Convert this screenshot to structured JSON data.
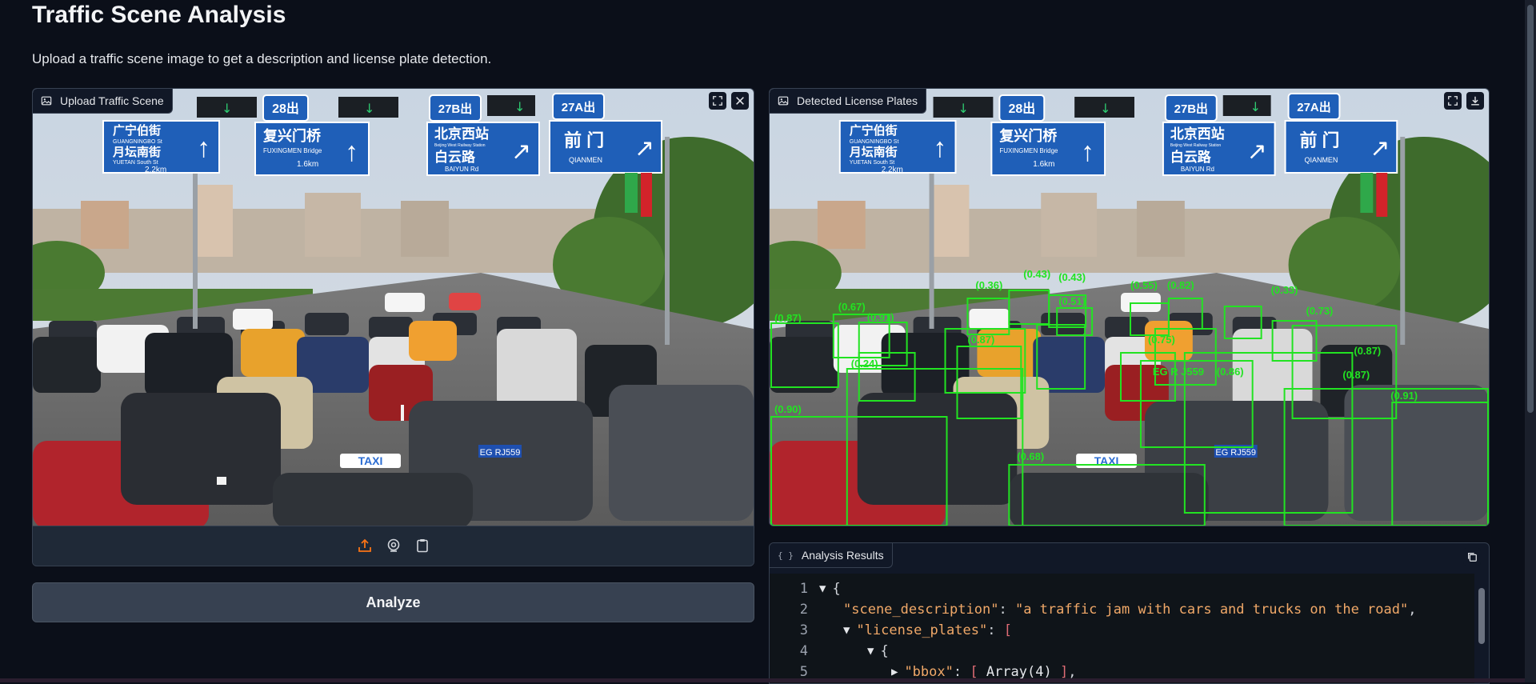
{
  "page": {
    "title": "Traffic Scene Analysis",
    "description": "Upload a traffic scene image to get a description and license plate detection."
  },
  "input_panel": {
    "label": "Upload Traffic Scene",
    "label_icon": "image-icon",
    "corner_icons": [
      "fullscreen-icon",
      "close-icon"
    ],
    "source_icons": [
      "upload-icon",
      "webcam-icon",
      "clipboard-icon"
    ],
    "accent": "#f97316"
  },
  "output_panel": {
    "label": "Detected License Plates",
    "label_icon": "image-icon",
    "corner_icons": [
      "fullscreen-icon",
      "download-icon"
    ]
  },
  "scene": {
    "signs": [
      {
        "cn": "广宁伯街",
        "en1": "GUANGNINGBO St",
        "cn2": "月坛南街",
        "en2": "YUETAN South St",
        "dist": "2.2km",
        "arrow": "↑"
      },
      {
        "cn": "复兴门桥",
        "en1": "FUXINGMEN Bridge",
        "dist": "1.6km",
        "arrow": "↑"
      },
      {
        "cn": "北京西站",
        "en1": "Beijing West Railway Station",
        "cn2": "白云路",
        "en2": "BAIYUN Rd",
        "arrow": "↗"
      },
      {
        "cn": "前 门",
        "en1": "QIANMEN",
        "arrow": "↗"
      }
    ],
    "route_badges": [
      "28出",
      "27B出",
      "27A出"
    ],
    "plate_text": "EG RJ559",
    "taxi_text": "TAXI"
  },
  "detections": {
    "box_color": "#22e322",
    "labels": [
      "(0.87)",
      "(0.67)",
      "(0.91)",
      "(0.36)",
      "(0.43)",
      "(0.43)",
      "(0.51)",
      "(0.55)",
      "(0.82)",
      "(0.33)",
      "(0.73)",
      "(0.87)",
      "(0.24)",
      "(0.87)",
      "(0.75)",
      "(0.86)",
      "(0.87)",
      "(0.91)",
      "(0.90)",
      "(0.68)",
      "EG R J559"
    ]
  },
  "analyze_button": {
    "label": "Analyze"
  },
  "results": {
    "label": "Analysis Results",
    "label_icon": "json-icon",
    "copy_icon": "copy-icon",
    "lines": [
      {
        "num": "1",
        "text": "{"
      },
      {
        "num": "2",
        "key": "\"scene_description\"",
        "value": "\"a traffic jam with cars and trucks on the road\""
      },
      {
        "num": "3",
        "key": "\"license_plates\"",
        "bracket": "["
      },
      {
        "num": "4",
        "text": "{"
      },
      {
        "num": "5",
        "key": "\"bbox\"",
        "collapsed": "Array(4)"
      }
    ]
  }
}
